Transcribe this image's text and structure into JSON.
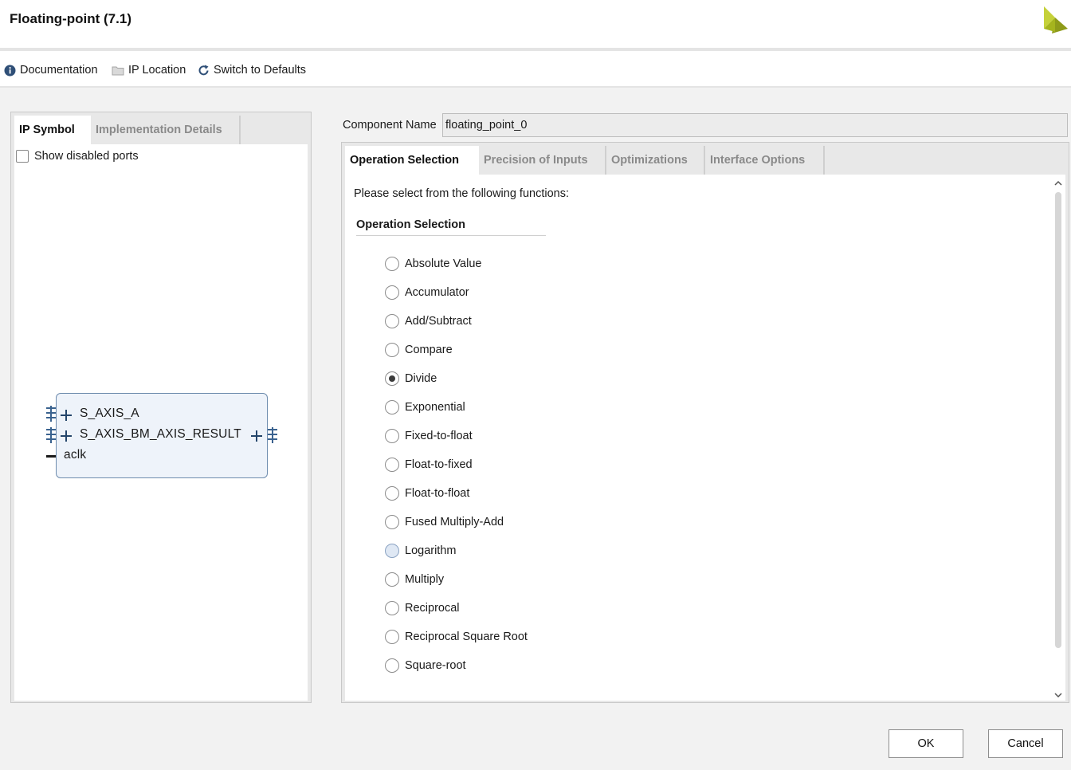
{
  "window": {
    "title": "Floating-point (7.1)"
  },
  "toolbar": {
    "documentation": "Documentation",
    "ip_location": "IP Location",
    "switch_defaults": "Switch to Defaults"
  },
  "left_panel": {
    "tabs": [
      "IP Symbol",
      "Implementation Details"
    ],
    "show_disabled_ports": "Show disabled ports",
    "ip_symbol": {
      "ports_in": [
        "S_AXIS_A",
        "S_AXIS_BM_AXIS_RESULT"
      ],
      "clock_port": "aclk"
    }
  },
  "component": {
    "label": "Component Name",
    "value": "floating_point_0"
  },
  "right_panel": {
    "tabs": [
      "Operation Selection",
      "Precision of Inputs",
      "Optimizations",
      "Interface Options"
    ],
    "intro": "Please select from the following functions:",
    "section_title": "Operation Selection",
    "selected": "Divide",
    "operations": [
      "Absolute Value",
      "Accumulator",
      "Add/Subtract",
      "Compare",
      "Divide",
      "Exponential",
      "Fixed-to-float",
      "Float-to-fixed",
      "Float-to-float",
      "Fused Multiply-Add",
      "Logarithm",
      "Multiply",
      "Reciprocal",
      "Reciprocal Square Root",
      "Square-root"
    ]
  },
  "buttons": {
    "ok": "OK",
    "cancel": "Cancel"
  },
  "colors": {
    "logo": "#a5b41e",
    "symbol_border": "#6e8cae",
    "symbol_fill": "#eef3fa"
  }
}
